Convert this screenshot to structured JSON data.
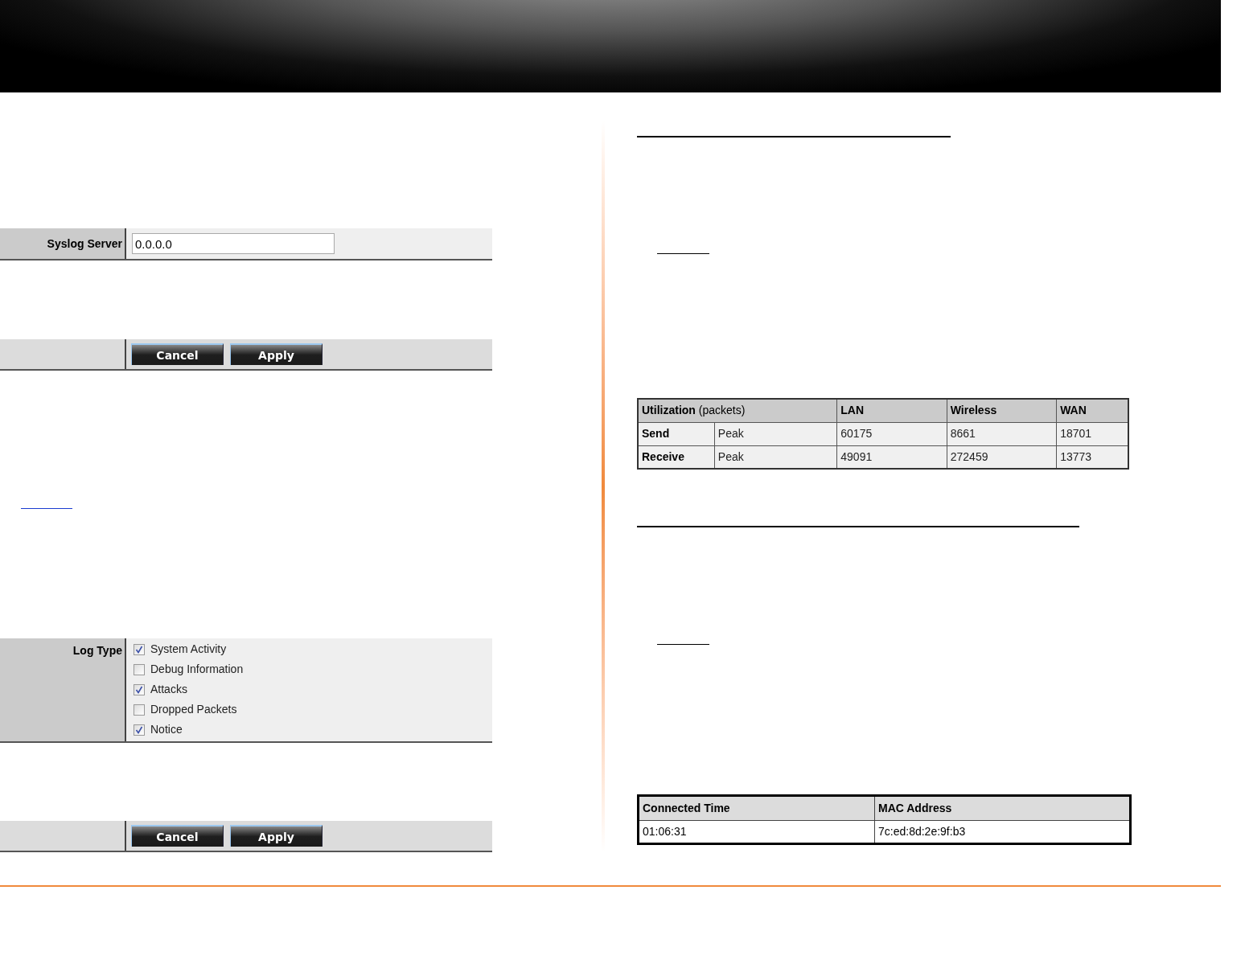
{
  "syslog_panel": {
    "label": "Syslog Server",
    "value": "0.0.0.0"
  },
  "syslog_buttons": [
    "Cancel",
    "Apply"
  ],
  "log_type_panel": {
    "label": "Log Type",
    "options": [
      {
        "label": "System Activity",
        "checked": true
      },
      {
        "label": "Debug Information",
        "checked": false
      },
      {
        "label": "Attacks",
        "checked": true
      },
      {
        "label": "Dropped Packets",
        "checked": false
      },
      {
        "label": "Notice",
        "checked": true
      }
    ]
  },
  "log_buttons": [
    "Cancel",
    "Apply"
  ],
  "utilization_table": {
    "columns": [
      {
        "label": "**Utilization** (packets)",
        "colspan": 2
      },
      {
        "label": "LAN"
      },
      {
        "label": "Wireless"
      },
      {
        "label": "WAN"
      }
    ],
    "rows": [
      {
        "cells": [
          "Send",
          "Peak",
          "60175",
          "8661",
          "18701"
        ]
      },
      {
        "cells": [
          "Receive",
          "Peak",
          "49091",
          "272459",
          "13773"
        ]
      }
    ]
  },
  "client_table": {
    "columns": [
      "Connected Time",
      "MAC Address"
    ],
    "rows": [
      {
        "cells": [
          "01:06:31",
          "7c:ed:8d:2e:9f:b3"
        ]
      }
    ]
  }
}
